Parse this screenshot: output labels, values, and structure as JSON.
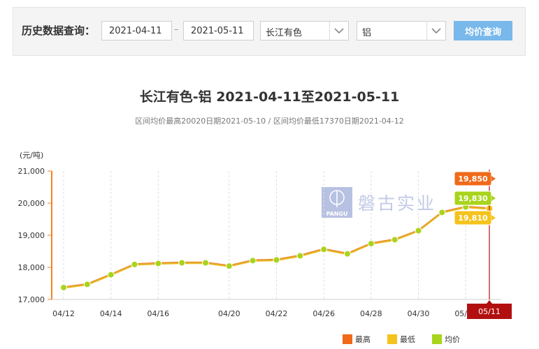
{
  "query": {
    "label": "历史数据查询：",
    "start_date": "2021-04-11",
    "separator": "–",
    "end_date": "2021-05-11",
    "market": "长江有色",
    "metal": "铝",
    "button_label": "均价查询"
  },
  "watermark": {
    "brand_text": "磐古实业",
    "logo_text": "PANGU"
  },
  "colors": {
    "high": "#f06a1a",
    "low": "#f5c31d",
    "avg": "#a8d41c",
    "avg_line": "#e3b02a",
    "axis_left": "#f58220",
    "cursor": "#b21010"
  },
  "chart_data": {
    "type": "line",
    "title": "长江有色-铝 2021-04-11至2021-05-11",
    "subtitle": "区间均价最高20020日期2021-05-10 / 区间均价最低17370日期2021-04-12",
    "ylabel": "(元/吨)",
    "ylim": [
      17000,
      21000
    ],
    "yticks": [
      "17,000",
      "18,000",
      "19,000",
      "20,000",
      "21,000"
    ],
    "yticks_values": [
      17000,
      18000,
      19000,
      20000,
      21000
    ],
    "x": [
      "04/12",
      "04/13",
      "04/14",
      "04/15",
      "04/16",
      "04/17",
      "04/19",
      "04/20",
      "04/21",
      "04/22",
      "04/23",
      "04/26",
      "04/27",
      "04/28",
      "04/29",
      "04/30",
      "05/06",
      "05/07",
      "05/11"
    ],
    "xticks": [
      "04/12",
      "04/14",
      "04/16",
      "04/20",
      "04/22",
      "04/26",
      "04/28",
      "04/30",
      "05/07",
      "05/11"
    ],
    "series": [
      {
        "name": "最高",
        "values": [
          17390,
          17490,
          17790,
          18110,
          18140,
          18160,
          18160,
          18060,
          18230,
          18250,
          18380,
          18580,
          18440,
          18760,
          18880,
          19160,
          19730,
          19900,
          19850
        ]
      },
      {
        "name": "最低",
        "values": [
          17350,
          17450,
          17750,
          18070,
          18100,
          18120,
          18120,
          18020,
          18190,
          18210,
          18340,
          18540,
          18400,
          18720,
          18840,
          19120,
          19690,
          19860,
          19810
        ]
      },
      {
        "name": "均价",
        "values": [
          17370,
          17470,
          17770,
          18090,
          18120,
          18140,
          18140,
          18040,
          18210,
          18230,
          18360,
          18560,
          18420,
          18740,
          18860,
          19140,
          19710,
          19880,
          19830
        ]
      }
    ],
    "tooltip": {
      "date": "05/11",
      "high": "19,850",
      "avg": "19,830",
      "low": "19,810"
    },
    "legend": [
      "最高",
      "最低",
      "均价"
    ],
    "legend_position": "bottom-right",
    "grid": {
      "x": true,
      "y": false
    }
  }
}
